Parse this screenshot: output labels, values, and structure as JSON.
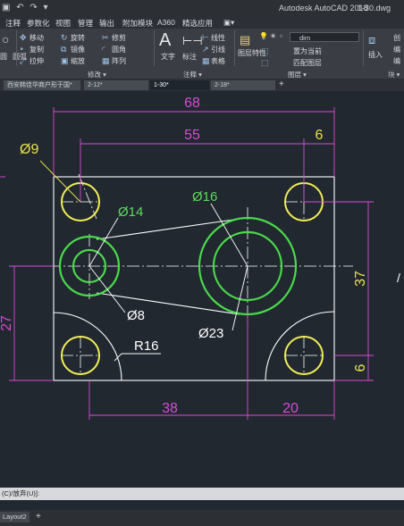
{
  "titlebar": {
    "quick_access": "▣ ↶ ↷ ▾",
    "app_title": "Autodesk AutoCAD 2018",
    "file_name": "1-30.dwg"
  },
  "menu": {
    "items": [
      "注释",
      "参数化",
      "视图",
      "管理",
      "输出",
      "附加模块",
      "A360",
      "精选应用",
      "▣▾"
    ]
  },
  "ribbon": {
    "left_cut": [
      "圆",
      "圆弧"
    ],
    "modify": {
      "items": [
        {
          "icon": "✥",
          "label": "移动"
        },
        {
          "icon": "↻",
          "label": "旋转"
        },
        {
          "icon": "✂",
          "label": "修剪"
        },
        {
          "icon": "⁍",
          "label": "复制"
        },
        {
          "icon": "⧉",
          "label": "镜像"
        },
        {
          "icon": "◜",
          "label": "圆角"
        },
        {
          "icon": "⤢",
          "label": "拉伸"
        },
        {
          "icon": "▣",
          "label": "缩放"
        },
        {
          "icon": "▦",
          "label": "阵列"
        }
      ],
      "panel_label": "修改 ▾"
    },
    "annotation": {
      "text_label": "文字",
      "dim_label": "标注",
      "items": [
        "线性",
        "引线",
        "表格"
      ],
      "panel_label": "注释 ▾"
    },
    "layers": {
      "props_label": "图层特性",
      "current_layer": "dim",
      "items": [
        "置为当前",
        "匹配图层"
      ],
      "panel_label": "图层 ▾"
    },
    "block": {
      "insert_label": "插入",
      "panel_label": "块 ▾",
      "side_items": [
        "创",
        "编",
        "编"
      ]
    }
  },
  "tabs": [
    {
      "label": "西安韩佳华商户形于国*",
      "active": false
    },
    {
      "label": "2-12*",
      "active": false
    },
    {
      "label": "1-30*",
      "active": true
    },
    {
      "label": "2-18*",
      "active": false
    }
  ],
  "tab_add": "+",
  "drawing": {
    "colors": {
      "outline": "#ffffff",
      "yellow_circle": "#f2ee58",
      "green_circle": "#4bd94b",
      "dimension": "#d94bd4",
      "dim_green": "#5bdc5b",
      "dim_yellow": "#e8e24f",
      "center": "#ffffff"
    },
    "dims": {
      "d68": "68",
      "d55": "55",
      "d6_top": "6",
      "d37": "37",
      "d6_right": "6",
      "d27": "27",
      "d38": "38",
      "d20": "20"
    },
    "labels": {
      "phi9": "Ø9",
      "phi14": "Ø14",
      "phi16": "Ø16",
      "phi8": "Ø8",
      "phi23": "Ø23",
      "r16": "R16"
    }
  },
  "command_line": "(C)/放弃(U)]:",
  "layout_tab": {
    "label": "Layout2",
    "add": "+"
  }
}
